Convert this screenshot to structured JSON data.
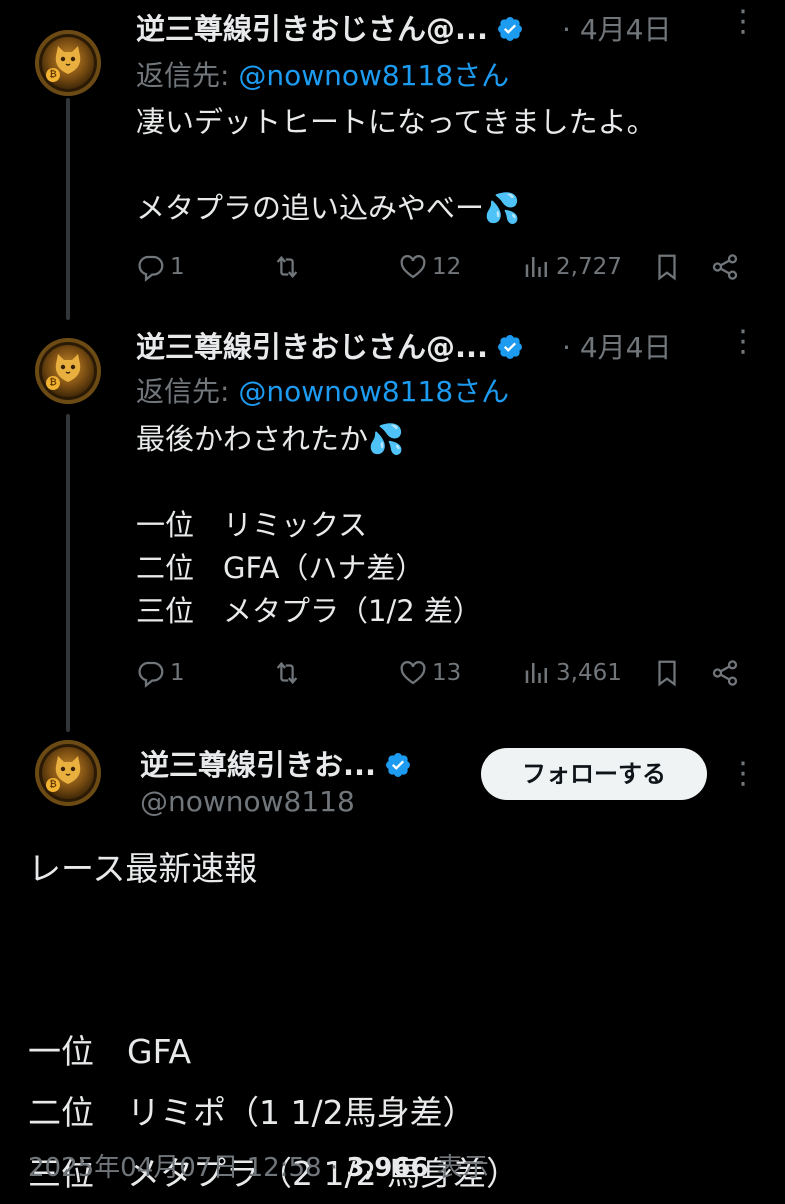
{
  "tweets": [
    {
      "name": "逆三尊線引きおじさん@...",
      "sep": "·",
      "date": "4月4日",
      "more": "⋮",
      "reply_prefix": "返信先:",
      "reply_handle": "@nownow8118さん",
      "text": "凄いデットヒートになってきましたよ。\n\nメタプラの追い込みやべー💦",
      "replies": "1",
      "retweets": "",
      "likes": "12",
      "views": "2,727"
    },
    {
      "name": "逆三尊線引きおじさん@...",
      "sep": "·",
      "date": "4月4日",
      "more": "⋮",
      "reply_prefix": "返信先:",
      "reply_handle": "@nownow8118さん",
      "text": "最後かわされたか💦\n\n一位　リミックス\n二位　GFA（ハナ差）\n三位　メタプラ（1/2 差）",
      "replies": "1",
      "retweets": "",
      "likes": "13",
      "views": "3,461"
    }
  ],
  "main": {
    "name": "逆三尊線引きお...",
    "handle": "@nownow8118",
    "follow_label": "フォローする",
    "more": "⋮",
    "text": "レース最新速報\n\n\n一位　GFA\n二位　リミポ（1 1/2馬身差）\n三位　メタプラ（2 1/2 馬身差）",
    "timestamp": "2025年04月07日 12:58",
    "sep": "·",
    "views_count": "3,966",
    "views_label": "表示"
  },
  "colors": {
    "background": "#000000",
    "text": "#e7e9ea",
    "muted": "#71767b",
    "link": "#1d9bf0",
    "verified": "#1d9bf0",
    "follow_bg": "#eff3f4"
  },
  "icons": [
    "reply-icon",
    "retweet-icon",
    "like-icon",
    "views-icon",
    "bookmark-icon",
    "share-icon",
    "verified-badge-icon",
    "more-options-icon"
  ]
}
